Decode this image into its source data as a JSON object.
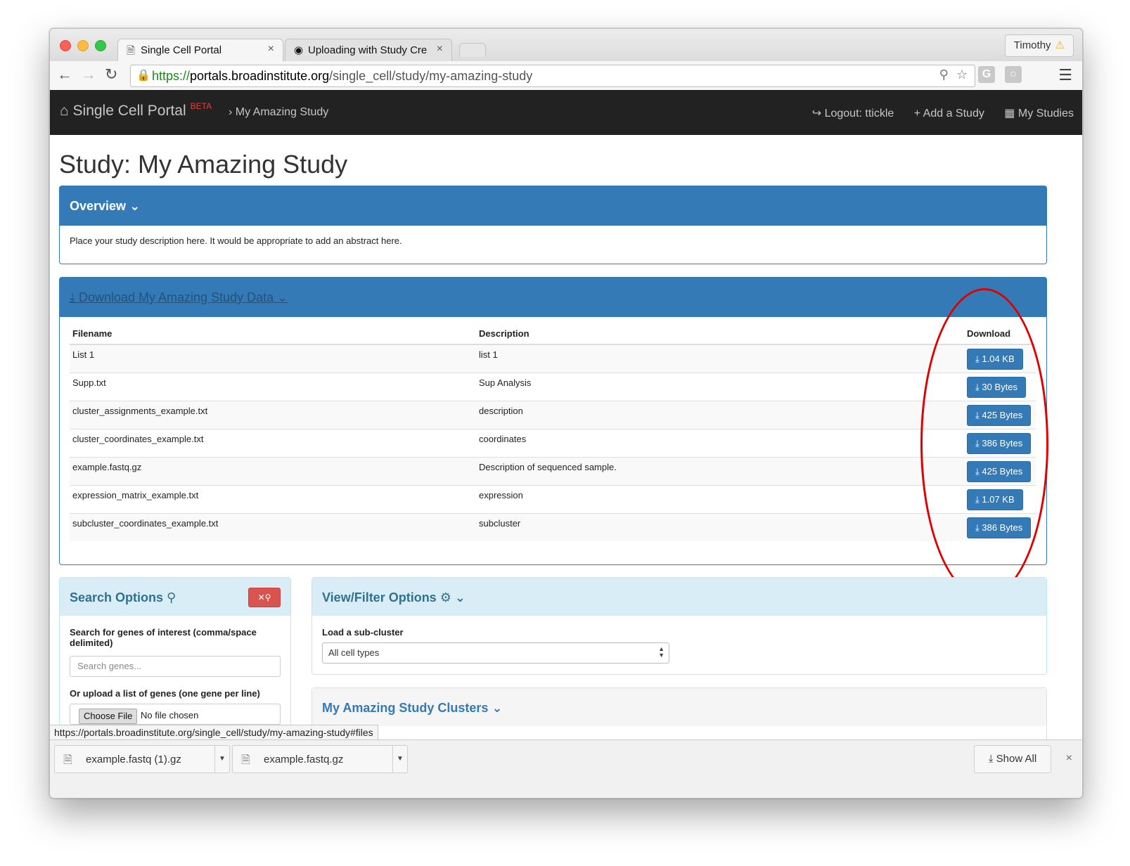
{
  "browser": {
    "profile_name": "Timothy",
    "tabs": [
      {
        "title": "Single Cell Portal",
        "close": "×"
      },
      {
        "title": "Uploading with Study Crea",
        "close": "×"
      }
    ],
    "url": {
      "scheme": "https://",
      "domain": "portals.broadinstitute.org",
      "path": "/single_cell/study/my-amazing-study"
    },
    "status_url": "https://portals.broadinstitute.org/single_cell/study/my-amazing-study#files"
  },
  "navbar": {
    "brand": "Single Cell Portal",
    "beta": "BETA",
    "crumb": "My Amazing Study",
    "logout": "Logout: ttickle",
    "add_study": "Add a Study",
    "my_studies": "My Studies"
  },
  "page": {
    "title": "Study: My Amazing Study"
  },
  "overview": {
    "heading": "Overview",
    "description": "Place your study description here. It would be appropriate to add an abstract here."
  },
  "downloads": {
    "heading": "Download My Amazing Study Data",
    "columns": {
      "filename": "Filename",
      "description": "Description",
      "download": "Download"
    },
    "rows": [
      {
        "filename": "List 1",
        "description": "list 1",
        "size": "1.04 KB"
      },
      {
        "filename": "Supp.txt",
        "description": "Sup Analysis",
        "size": "30 Bytes"
      },
      {
        "filename": "cluster_assignments_example.txt",
        "description": "description",
        "size": "425 Bytes"
      },
      {
        "filename": "cluster_coordinates_example.txt",
        "description": "coordinates",
        "size": "386 Bytes"
      },
      {
        "filename": "example.fastq.gz",
        "description": "Description of sequenced sample.",
        "size": "425 Bytes"
      },
      {
        "filename": "expression_matrix_example.txt",
        "description": "expression",
        "size": "1.07 KB"
      },
      {
        "filename": "subcluster_coordinates_example.txt",
        "description": "subcluster",
        "size": "386 Bytes"
      }
    ]
  },
  "search": {
    "heading": "Search Options",
    "genes_label": "Search for genes of interest (comma/space delimited)",
    "genes_placeholder": "Search genes...",
    "upload_label": "Or upload a list of genes (one gene per line)",
    "choose_file": "Choose File",
    "no_file": "No file chosen"
  },
  "view_filter": {
    "heading": "View/Filter Options",
    "subcluster_label": "Load a sub-cluster",
    "subcluster_value": "All cell types"
  },
  "clusters": {
    "heading": "My Amazing Study Clusters"
  },
  "download_shelf": {
    "items": [
      "example.fastq (1).gz",
      "example.fastq.gz"
    ],
    "show_all": "Show All",
    "close": "×"
  },
  "colors": {
    "primary": "#337ab7",
    "navbar": "#222222",
    "danger": "#d9534f",
    "info_bg": "#d9edf7",
    "annotation_circle": "#e00000"
  },
  "icons": {
    "home": "home-icon",
    "download": "download-icon",
    "search": "search-icon",
    "gear": "gear-icon",
    "chevron": "chevron-down-icon"
  }
}
